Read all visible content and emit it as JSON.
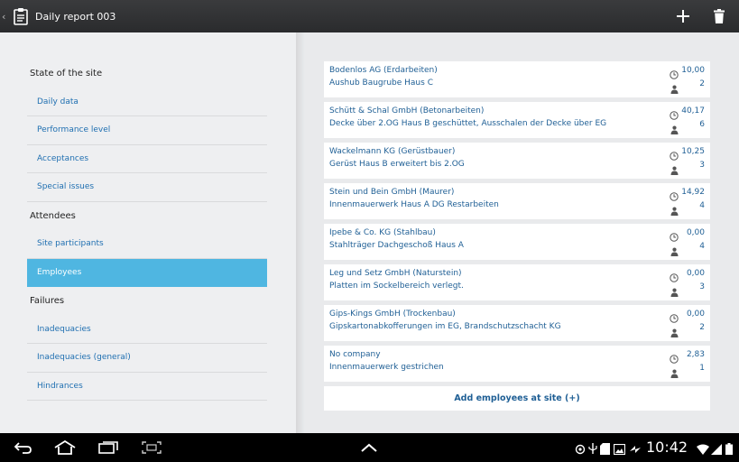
{
  "actionbar": {
    "title": "Daily report 003",
    "back_glyph": "‹",
    "icons": [
      "app-logo-icon",
      "add-icon",
      "trash-icon"
    ]
  },
  "nav": {
    "groups": [
      {
        "header": "State of the site",
        "items": [
          "Daily data",
          "Performance level",
          "Acceptances",
          "Special issues"
        ]
      },
      {
        "header": "Attendees",
        "items": [
          "Site participants",
          "Employees"
        ]
      },
      {
        "header": "Failures",
        "items": [
          "Inadequacies",
          "Inadequacies (general)",
          "Hindrances"
        ]
      }
    ],
    "active_item": "Employees"
  },
  "entries": [
    {
      "company": "Bodenlos AG (Erdarbeiten)",
      "task": "Aushub Baugrube Haus C",
      "hours": "10,00",
      "count": "2"
    },
    {
      "company": "Schütt & Schal GmbH (Betonarbeiten)",
      "task": "Decke über 2.OG Haus B geschüttet, Ausschalen der Decke über EG",
      "hours": "40,17",
      "count": "6"
    },
    {
      "company": "Wackelmann KG (Gerüstbauer)",
      "task": "Gerüst Haus B erweitert bis 2.OG",
      "hours": "10,25",
      "count": "3"
    },
    {
      "company": "Stein und Bein GmbH (Maurer)",
      "task": "Innenmauerwerk Haus A DG Restarbeiten",
      "hours": "14,92",
      "count": "4"
    },
    {
      "company": "Ipebe & Co. KG (Stahlbau)",
      "task": "Stahlträger Dachgeschoß Haus A",
      "hours": "0,00",
      "count": "4"
    },
    {
      "company": "Leg und Setz GmbH (Naturstein)",
      "task": "Platten im Sockelbereich verlegt.",
      "hours": "0,00",
      "count": "3"
    },
    {
      "company": "Gips-Kings GmbH (Trockenbau)",
      "task": "Gipskartonabkofferungen im EG, Brandschutzschacht KG",
      "hours": "0,00",
      "count": "2"
    },
    {
      "company": "No company",
      "task": "Innenmauerwerk gestrichen",
      "hours": "2,83",
      "count": "1"
    }
  ],
  "add_button_label": "Add employees at site (+)",
  "systembar": {
    "time": "10:42",
    "buttons": [
      "back-icon",
      "home-icon",
      "recent-apps-icon",
      "screenshot-icon",
      "chevron-up-icon"
    ],
    "status_icons": [
      "android-icon",
      "usb-icon",
      "sd-card-icon",
      "image-icon",
      "wifi-icon",
      "signal-icon",
      "battery-icon"
    ]
  },
  "colors": {
    "actionbar": "#2f3032",
    "active_nav": "#4fb6e1",
    "link_text": "#1f5f95",
    "background": "#e9eaec"
  }
}
